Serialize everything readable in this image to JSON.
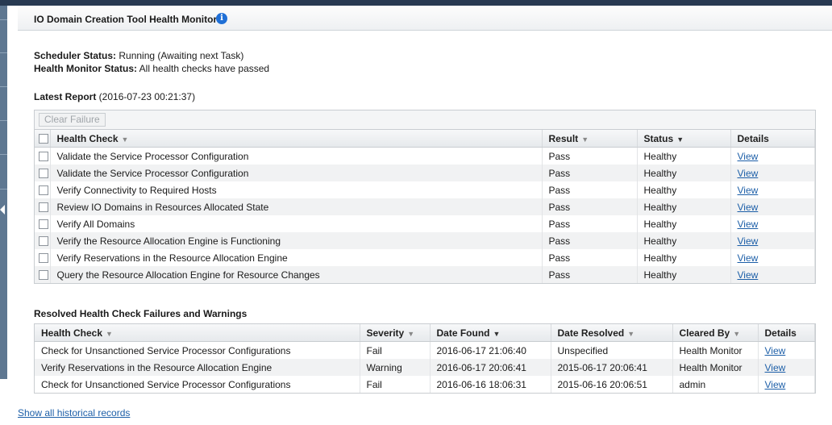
{
  "header": {
    "title": "IO Domain Creation Tool Health Monitor",
    "info_glyph": "i"
  },
  "status": {
    "scheduler_label": "Scheduler Status:",
    "scheduler_value": " Running (Awaiting next Task)",
    "health_label": "Health Monitor Status:",
    "health_value": " All health checks have passed"
  },
  "latest": {
    "title": "Latest Report",
    "timestamp": " (2016-07-23 00:21:37)",
    "clear_button": "Clear Failure",
    "columns": [
      "Health Check",
      "Result",
      "Status",
      "Details"
    ],
    "rows": [
      {
        "check": "Validate the Service Processor Configuration",
        "result": "Pass",
        "status": "Healthy",
        "details": "View"
      },
      {
        "check": "Validate the Service Processor Configuration",
        "result": "Pass",
        "status": "Healthy",
        "details": "View"
      },
      {
        "check": "Verify Connectivity to Required Hosts",
        "result": "Pass",
        "status": "Healthy",
        "details": "View"
      },
      {
        "check": "Review IO Domains in Resources Allocated State",
        "result": "Pass",
        "status": "Healthy",
        "details": "View"
      },
      {
        "check": "Verify All Domains",
        "result": "Pass",
        "status": "Healthy",
        "details": "View"
      },
      {
        "check": "Verify the Resource Allocation Engine is Functioning",
        "result": "Pass",
        "status": "Healthy",
        "details": "View"
      },
      {
        "check": "Verify Reservations in the Resource Allocation Engine",
        "result": "Pass",
        "status": "Healthy",
        "details": "View"
      },
      {
        "check": "Query the Resource Allocation Engine for Resource Changes",
        "result": "Pass",
        "status": "Healthy",
        "details": "View"
      }
    ]
  },
  "resolved": {
    "title": "Resolved Health Check Failures and Warnings",
    "columns": [
      "Health Check",
      "Severity",
      "Date Found",
      "Date Resolved",
      "Cleared By",
      "Details"
    ],
    "rows": [
      {
        "check": "Check for Unsanctioned Service Processor Configurations",
        "severity": "Fail",
        "found": "2016-06-17 21:06:40",
        "resolved": "Unspecified",
        "cleared_by": "Health Monitor",
        "details": "View"
      },
      {
        "check": "Verify Reservations in the Resource Allocation Engine",
        "severity": "Warning",
        "found": "2016-06-17 20:06:41",
        "resolved": "2015-06-17 20:06:41",
        "cleared_by": "Health Monitor",
        "details": "View"
      },
      {
        "check": "Check for Unsanctioned Service Processor Configurations",
        "severity": "Fail",
        "found": "2016-06-16 18:06:31",
        "resolved": "2015-06-16 20:06:51",
        "cleared_by": "admin",
        "details": "View"
      }
    ]
  },
  "footer": {
    "history_link": "Show all historical records"
  },
  "colors": {
    "link": "#1d5fa8",
    "info_icon": "#1f6fd6",
    "top_bar": "#283a52"
  }
}
